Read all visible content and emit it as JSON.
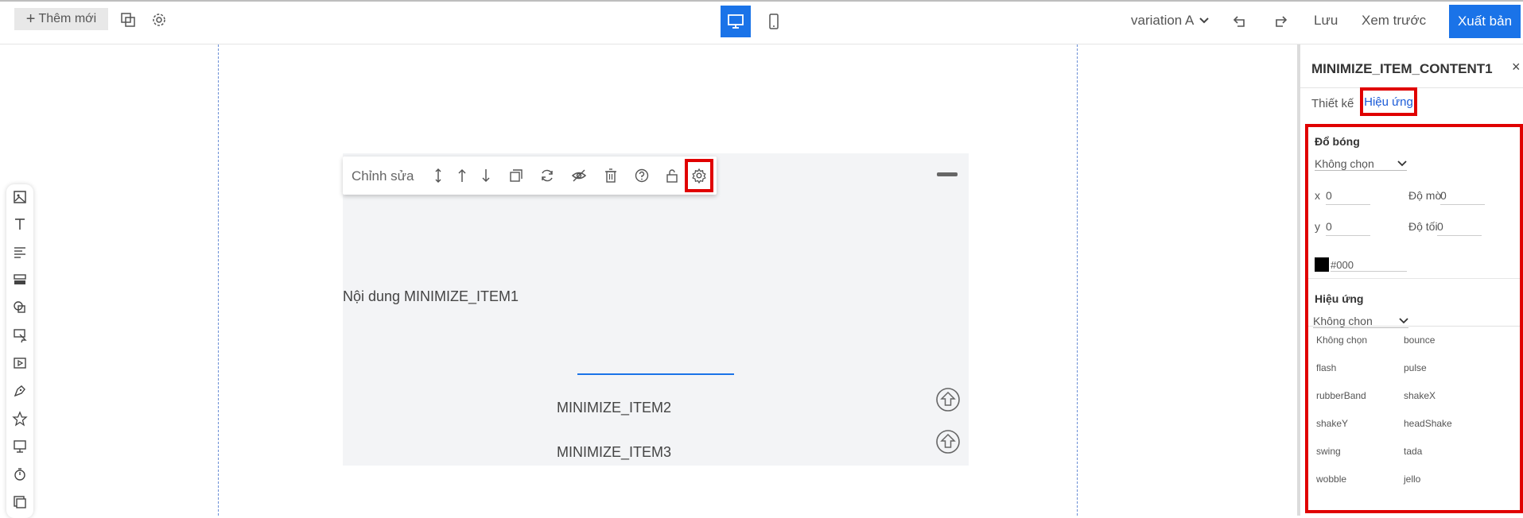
{
  "topbar": {
    "add_new_label": "Thêm mới",
    "variation_label": "variation A",
    "save_label": "Lưu",
    "preview_label": "Xem trước",
    "publish_label": "Xuất bản",
    "accent_color": "#1a73e8"
  },
  "edit_toolbar": {
    "edit_label": "Chỉnh sửa",
    "icons": [
      "resize-vertical-icon",
      "move-up-icon",
      "move-down-icon",
      "duplicate-icon",
      "refresh-icon",
      "hide-icon",
      "trash-icon",
      "help-icon",
      "unlock-icon",
      "gear-icon"
    ]
  },
  "canvas": {
    "item1": "Nội dung MINIMIZE_ITEM1",
    "item2": "MINIMIZE_ITEM2",
    "item3": "MINIMIZE_ITEM3"
  },
  "left_toolbar": {
    "icons": [
      "image-icon",
      "text-icon",
      "paragraph-icon",
      "form-icon",
      "shape-icon",
      "cursor-icon",
      "video-icon",
      "pen-icon",
      "star-icon",
      "display-icon",
      "timer-icon",
      "layers-icon"
    ]
  },
  "panel": {
    "title": "MINIMIZE_ITEM_CONTENT1",
    "close": "×",
    "tab_design": "Thiết kế",
    "tab_effect": "Hiệu ứng",
    "shadow": {
      "title": "Đổ bóng",
      "select_value": "Không chọn",
      "x_label": "x",
      "x_value": "0",
      "blur_label": "Độ mờ",
      "blur_value": "0",
      "y_label": "y",
      "y_value": "0",
      "dark_label": "Độ tối",
      "dark_value": "0",
      "color_value": "#000"
    },
    "effect": {
      "title": "Hiệu ứng",
      "select_value": "Không chọn",
      "options": [
        "Không chọn",
        "bounce",
        "flash",
        "pulse",
        "rubberBand",
        "shakeX",
        "shakeY",
        "headShake",
        "swing",
        "tada",
        "wobble",
        "jello"
      ]
    }
  }
}
